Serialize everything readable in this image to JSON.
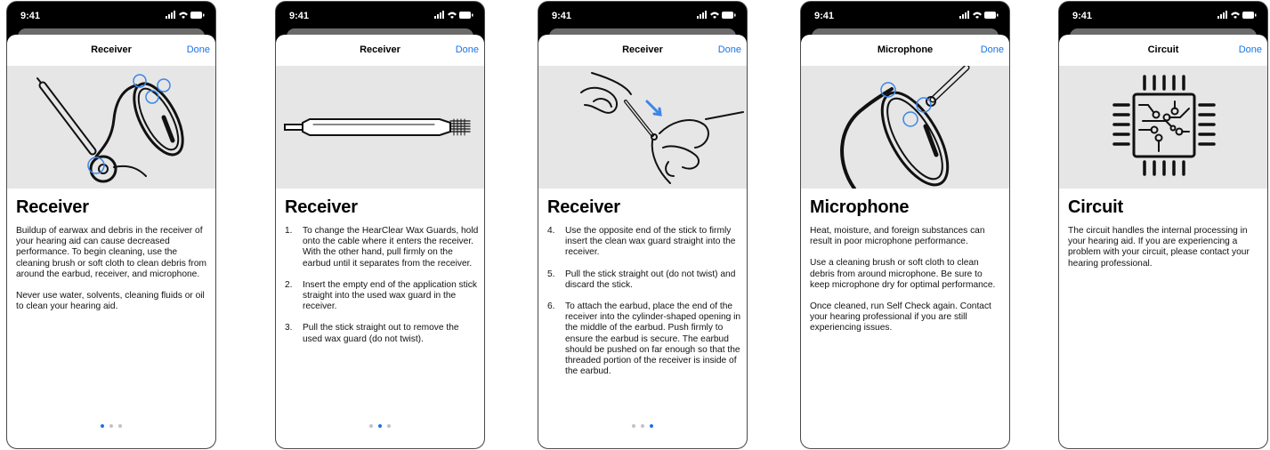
{
  "status": {
    "time": "9:41"
  },
  "nav": {
    "done_label": "Done"
  },
  "screens": [
    {
      "nav_title": "Receiver",
      "heading": "Receiver",
      "paragraphs": [
        "Buildup of earwax and debris in the receiver of your hearing aid can cause decreased performance. To begin cleaning, use the cleaning brush or soft cloth to clean debris from around the earbud, receiver, and microphone.",
        "Never use water, solvents, cleaning fluids or oil to clean your hearing aid."
      ],
      "illustration": "hearing-aid-receiver-icon",
      "page_count": 3,
      "active_page": 1
    },
    {
      "nav_title": "Receiver",
      "heading": "Receiver",
      "steps": [
        {
          "num": "1.",
          "text": "To change the HearClear Wax Guards, hold onto the cable where it enters the receiver. With the other hand, pull firmly on the earbud until it separates from the receiver."
        },
        {
          "num": "2.",
          "text": "Insert the empty end of the application stick straight into the used wax guard in the receiver."
        },
        {
          "num": "3.",
          "text": "Pull the stick straight out to remove the used wax guard (do not twist)."
        }
      ],
      "illustration": "wax-guard-stick-icon",
      "page_count": 3,
      "active_page": 2
    },
    {
      "nav_title": "Receiver",
      "heading": "Receiver",
      "steps": [
        {
          "num": "4.",
          "text": "Use the opposite end of the stick to firmly insert the clean wax guard straight into the receiver."
        },
        {
          "num": "5.",
          "text": "Pull the stick straight out (do not twist) and discard the stick."
        },
        {
          "num": "6.",
          "text": "To attach the earbud, place the end of the receiver into the cylinder-shaped opening in the middle of the earbud. Push firmly to ensure the earbud is secure. The earbud should be pushed on far enough so that the threaded portion of the receiver is inside of the earbud."
        }
      ],
      "illustration": "hands-inserting-wax-guard-icon",
      "page_count": 3,
      "active_page": 3
    },
    {
      "nav_title": "Microphone",
      "heading": "Microphone",
      "paragraphs": [
        "Heat, moisture, and foreign substances can result in poor microphone performance.",
        "Use a cleaning brush or soft cloth to clean debris from around microphone. Be sure to keep microphone dry for optimal performance.",
        "Once cleaned, run Self Check again. Contact your hearing professional if you are still experiencing issues."
      ],
      "illustration": "hearing-aid-microphone-icon"
    },
    {
      "nav_title": "Circuit",
      "heading": "Circuit",
      "paragraphs": [
        "The circuit handles the internal processing in your hearing aid. If you are experiencing a problem with your circuit, please contact your hearing professional."
      ],
      "illustration": "circuit-chip-icon"
    }
  ],
  "colors": {
    "accent": "#1a73e8",
    "illustration_bg": "#e6e6e6",
    "highlight": "#3b86e8"
  }
}
